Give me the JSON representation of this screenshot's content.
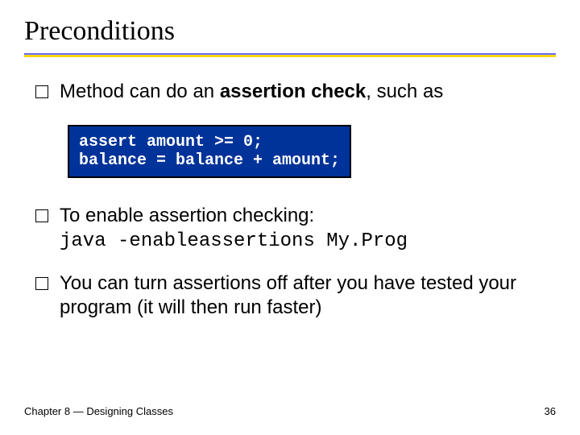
{
  "title": "Preconditions",
  "bullets": {
    "b1_pre": "Method can do an ",
    "b1_bold": "assertion check",
    "b1_post": ", such as",
    "b2_line1": "To enable assertion checking:",
    "b2_line2": "java -enableassertions My.Prog",
    "b3": "You can turn assertions off after you have tested your program (it will then run faster)"
  },
  "code": {
    "line1": "assert amount >= 0;",
    "line2": "balance = balance + amount;"
  },
  "footer": {
    "left": "Chapter 8 — Designing Classes",
    "right": "36"
  }
}
